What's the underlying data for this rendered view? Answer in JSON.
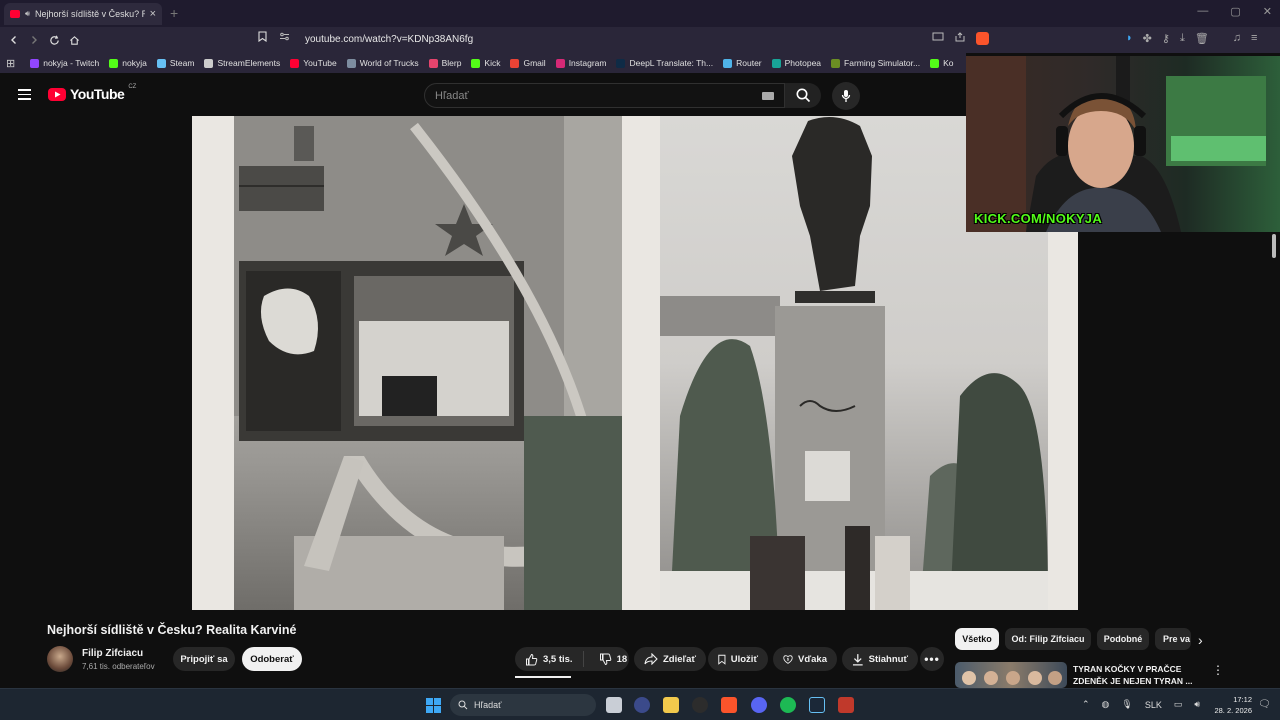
{
  "browser": {
    "tab_title": "Nejhorší sídliště v Česku? Re",
    "url": "youtube.com/watch?v=KDNp38AN6fg",
    "bookmarks": [
      {
        "label": "nokyja - Twitch",
        "color": "#9146ff"
      },
      {
        "label": "nokyja",
        "color": "#53fc18"
      },
      {
        "label": "Steam",
        "color": "#66c0f4"
      },
      {
        "label": "StreamElements",
        "color": "#cccccc"
      },
      {
        "label": "YouTube",
        "color": "#ff0033"
      },
      {
        "label": "World of Trucks",
        "color": "#7d8da0"
      },
      {
        "label": "Blerp",
        "color": "#e5446d"
      },
      {
        "label": "Kick",
        "color": "#53fc18"
      },
      {
        "label": "Gmail",
        "color": "#ea4335"
      },
      {
        "label": "Instagram",
        "color": "#d62976"
      },
      {
        "label": "DeepL Translate: Th...",
        "color": "#0f2b46"
      },
      {
        "label": "Router",
        "color": "#4fb3e8"
      },
      {
        "label": "Photopea",
        "color": "#18a497"
      },
      {
        "label": "Farming Simulator...",
        "color": "#6b8e23"
      },
      {
        "label": "Ko",
        "color": "#53fc18"
      }
    ]
  },
  "youtube": {
    "logo_text": "YouTube",
    "logo_region": "CZ",
    "search_placeholder": "Hľadať"
  },
  "overlay": {
    "kick_tag": "KICK.COM/NOKYJA"
  },
  "video": {
    "title": "Nejhorší sídliště v Česku? Realita Karviné",
    "channel_name": "Filip Zifciacu",
    "subscribers": "7,61 tis. odberateľov",
    "join_label": "Pripojiť sa",
    "subscribe_label": "Odoberať",
    "like_count": "3,5 tis.",
    "dislike_count": "18",
    "share_label": "Zdieľať",
    "save_label": "Uložiť",
    "thanks_label": "Vďaka",
    "download_label": "Stiahnuť"
  },
  "sidebar": {
    "chips": [
      "Všetko",
      "Od: Filip Zifciacu",
      "Podobné",
      "Pre va"
    ],
    "recommended": {
      "title": "TYRAN KOČKY V PRAČCE ZDENĚK JE NEJEN TYRAN ..."
    }
  },
  "taskbar": {
    "search_placeholder": "Hľadať",
    "language": "SLK",
    "time": "17:12",
    "date": "28. 2. 2026"
  }
}
